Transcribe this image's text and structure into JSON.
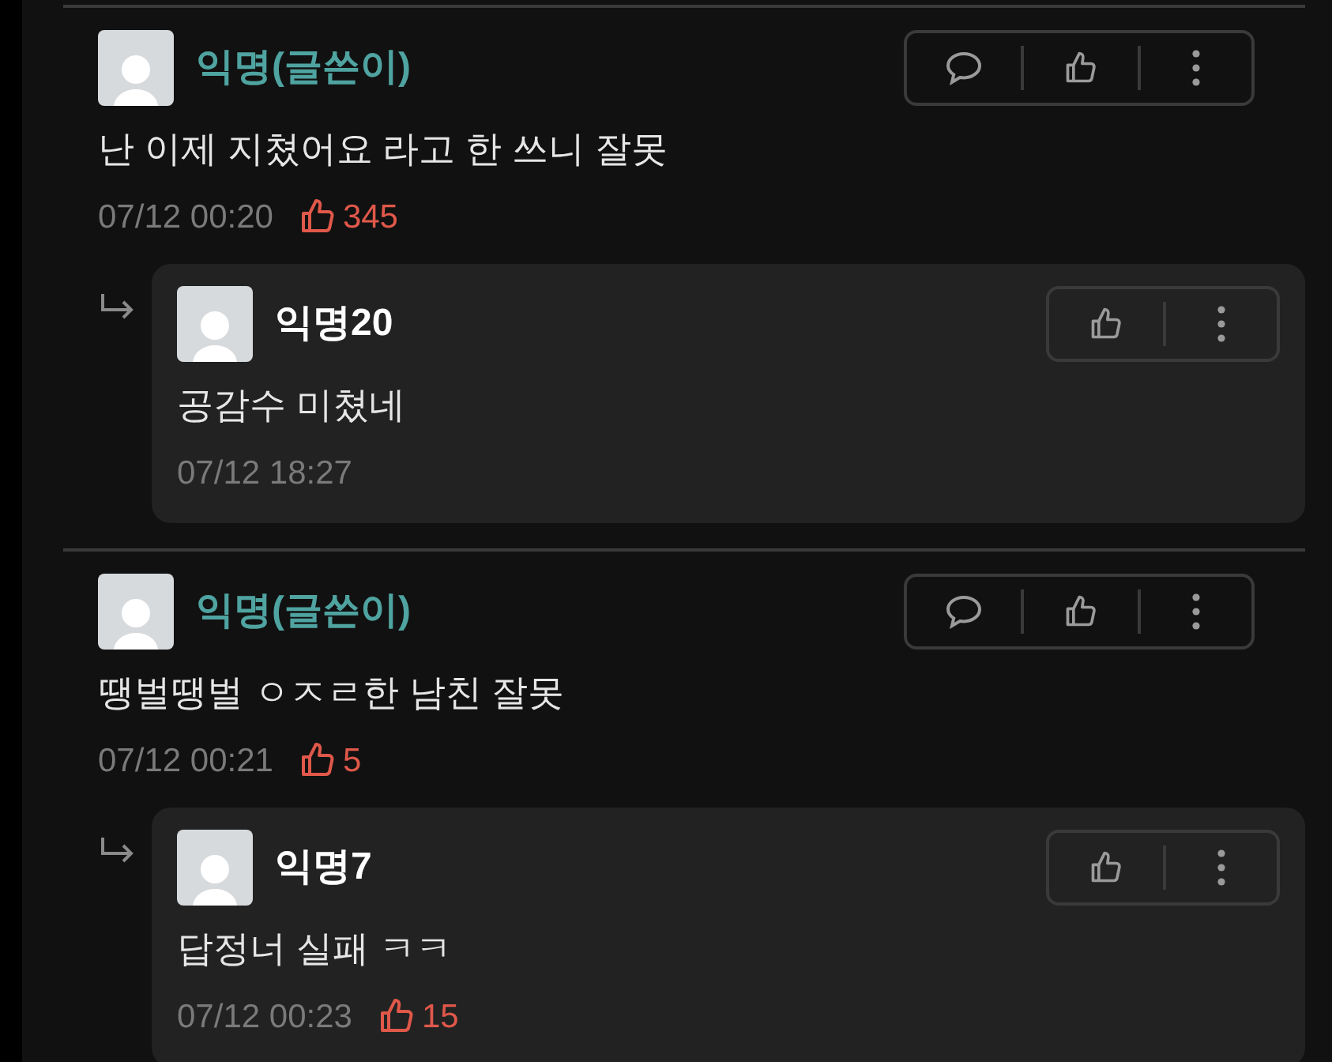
{
  "comments": [
    {
      "author": "익명(글쓴이)",
      "is_writer": true,
      "text": "난 이제 지쳤어요 라고 한 쓰니 잘못",
      "time": "07/12 00:20",
      "likes": "345",
      "replies": [
        {
          "author": "익명20",
          "is_writer": false,
          "text": "공감수 미쳤네",
          "time": "07/12 18:27"
        }
      ]
    },
    {
      "author": "익명(글쓴이)",
      "is_writer": true,
      "text": "땡벌땡벌 ㅇㅈㄹ한 남친 잘못",
      "time": "07/12 00:21",
      "likes": "5",
      "replies": [
        {
          "author": "익명7",
          "is_writer": false,
          "text": "답정너 실패 ㅋㅋ",
          "time": "07/12 00:23",
          "likes": "15"
        }
      ]
    }
  ]
}
